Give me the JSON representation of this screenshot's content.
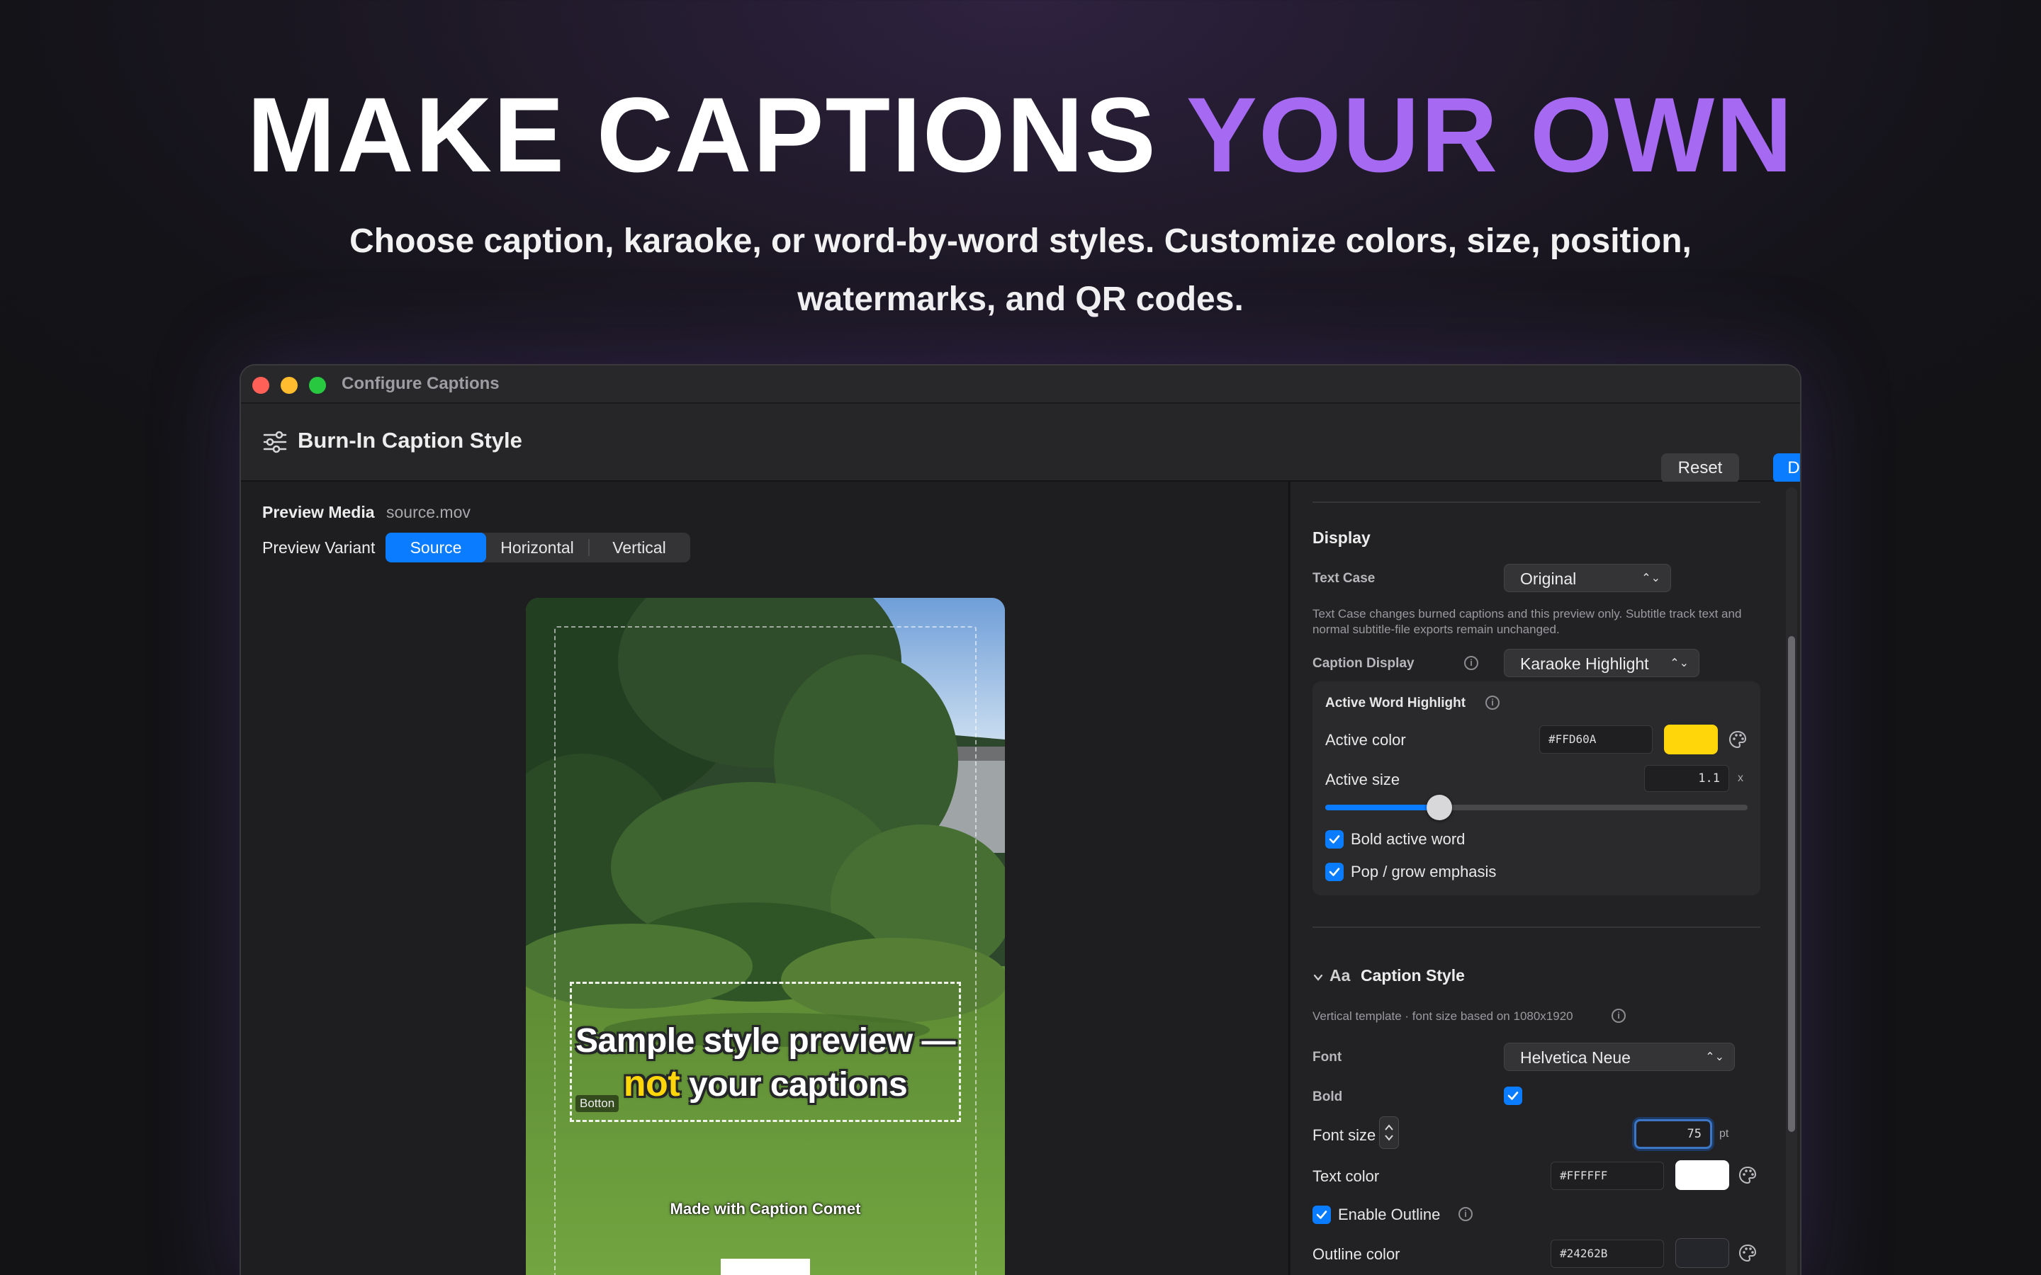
{
  "hero": {
    "title_main": "MAKE CAPTIONS ",
    "title_accent": "YOUR OWN",
    "subtitle": "Choose caption, karaoke, or word-by-word styles.  Customize colors, size, position, watermarks, and QR codes."
  },
  "window": {
    "title": "Configure Captions",
    "toolbar": {
      "title": "Burn-In Caption Style",
      "reset_label": "Reset",
      "done_label": "Done"
    }
  },
  "preview": {
    "media_label": "Preview Media",
    "media_file": "source.mov",
    "variant_label": "Preview Variant",
    "variants": [
      "Source",
      "Horizontal",
      "Vertical"
    ],
    "active_variant": "Source",
    "caption_line1": "Sample style preview —",
    "caption_highlight": "not",
    "caption_rest": " your captions",
    "position_tag": "Botton",
    "watermark": "Made with Caption Comet"
  },
  "display": {
    "title": "Display",
    "text_case_label": "Text Case",
    "text_case_value": "Original",
    "text_case_note": "Text Case changes burned captions and this preview only. Subtitle track text and normal subtitle-file exports remain unchanged.",
    "caption_display_label": "Caption Display",
    "caption_display_value": "Karaoke Highlight",
    "highlight": {
      "title": "Active Word Highlight",
      "active_color_label": "Active color",
      "active_color_hex": "#FFD60A",
      "active_color": "#ffd60a",
      "active_size_label": "Active size",
      "active_size_value": "1.1",
      "active_size_unit": "x",
      "active_size_fraction": 0.27,
      "bold_label": "Bold active word",
      "pop_label": "Pop / grow emphasis"
    }
  },
  "caption_style": {
    "title": "Caption Style",
    "aa_glyph": "Aa",
    "template_note": "Vertical template · font size based on 1080x1920",
    "font_label": "Font",
    "font_value": "Helvetica Neue",
    "bold_label": "Bold",
    "font_size_label": "Font size",
    "font_size_value": "75",
    "font_size_unit": "pt",
    "text_color_label": "Text color",
    "text_color_hex": "#FFFFFF",
    "text_color": "#ffffff",
    "enable_outline_label": "Enable Outline",
    "outline_color_label": "Outline color",
    "outline_color_hex": "#24262B",
    "outline_color": "#24262b"
  },
  "colors": {
    "accent": "#a66af2",
    "primary_blue": "#0a7cff"
  }
}
